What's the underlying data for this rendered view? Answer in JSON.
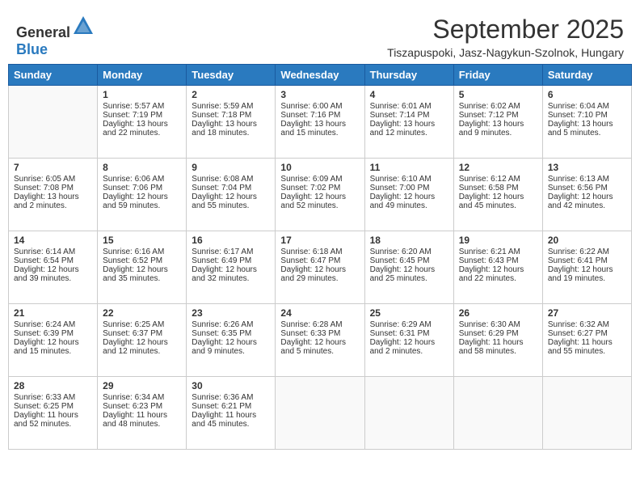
{
  "header": {
    "logo_general": "General",
    "logo_blue": "Blue",
    "month": "September 2025",
    "location": "Tiszapuspoki, Jasz-Nagykun-Szolnok, Hungary"
  },
  "days_of_week": [
    "Sunday",
    "Monday",
    "Tuesday",
    "Wednesday",
    "Thursday",
    "Friday",
    "Saturday"
  ],
  "weeks": [
    [
      {
        "day": "",
        "content": ""
      },
      {
        "day": "1",
        "content": "Sunrise: 5:57 AM\nSunset: 7:19 PM\nDaylight: 13 hours\nand 22 minutes."
      },
      {
        "day": "2",
        "content": "Sunrise: 5:59 AM\nSunset: 7:18 PM\nDaylight: 13 hours\nand 18 minutes."
      },
      {
        "day": "3",
        "content": "Sunrise: 6:00 AM\nSunset: 7:16 PM\nDaylight: 13 hours\nand 15 minutes."
      },
      {
        "day": "4",
        "content": "Sunrise: 6:01 AM\nSunset: 7:14 PM\nDaylight: 13 hours\nand 12 minutes."
      },
      {
        "day": "5",
        "content": "Sunrise: 6:02 AM\nSunset: 7:12 PM\nDaylight: 13 hours\nand 9 minutes."
      },
      {
        "day": "6",
        "content": "Sunrise: 6:04 AM\nSunset: 7:10 PM\nDaylight: 13 hours\nand 5 minutes."
      }
    ],
    [
      {
        "day": "7",
        "content": "Sunrise: 6:05 AM\nSunset: 7:08 PM\nDaylight: 13 hours\nand 2 minutes."
      },
      {
        "day": "8",
        "content": "Sunrise: 6:06 AM\nSunset: 7:06 PM\nDaylight: 12 hours\nand 59 minutes."
      },
      {
        "day": "9",
        "content": "Sunrise: 6:08 AM\nSunset: 7:04 PM\nDaylight: 12 hours\nand 55 minutes."
      },
      {
        "day": "10",
        "content": "Sunrise: 6:09 AM\nSunset: 7:02 PM\nDaylight: 12 hours\nand 52 minutes."
      },
      {
        "day": "11",
        "content": "Sunrise: 6:10 AM\nSunset: 7:00 PM\nDaylight: 12 hours\nand 49 minutes."
      },
      {
        "day": "12",
        "content": "Sunrise: 6:12 AM\nSunset: 6:58 PM\nDaylight: 12 hours\nand 45 minutes."
      },
      {
        "day": "13",
        "content": "Sunrise: 6:13 AM\nSunset: 6:56 PM\nDaylight: 12 hours\nand 42 minutes."
      }
    ],
    [
      {
        "day": "14",
        "content": "Sunrise: 6:14 AM\nSunset: 6:54 PM\nDaylight: 12 hours\nand 39 minutes."
      },
      {
        "day": "15",
        "content": "Sunrise: 6:16 AM\nSunset: 6:52 PM\nDaylight: 12 hours\nand 35 minutes."
      },
      {
        "day": "16",
        "content": "Sunrise: 6:17 AM\nSunset: 6:49 PM\nDaylight: 12 hours\nand 32 minutes."
      },
      {
        "day": "17",
        "content": "Sunrise: 6:18 AM\nSunset: 6:47 PM\nDaylight: 12 hours\nand 29 minutes."
      },
      {
        "day": "18",
        "content": "Sunrise: 6:20 AM\nSunset: 6:45 PM\nDaylight: 12 hours\nand 25 minutes."
      },
      {
        "day": "19",
        "content": "Sunrise: 6:21 AM\nSunset: 6:43 PM\nDaylight: 12 hours\nand 22 minutes."
      },
      {
        "day": "20",
        "content": "Sunrise: 6:22 AM\nSunset: 6:41 PM\nDaylight: 12 hours\nand 19 minutes."
      }
    ],
    [
      {
        "day": "21",
        "content": "Sunrise: 6:24 AM\nSunset: 6:39 PM\nDaylight: 12 hours\nand 15 minutes."
      },
      {
        "day": "22",
        "content": "Sunrise: 6:25 AM\nSunset: 6:37 PM\nDaylight: 12 hours\nand 12 minutes."
      },
      {
        "day": "23",
        "content": "Sunrise: 6:26 AM\nSunset: 6:35 PM\nDaylight: 12 hours\nand 9 minutes."
      },
      {
        "day": "24",
        "content": "Sunrise: 6:28 AM\nSunset: 6:33 PM\nDaylight: 12 hours\nand 5 minutes."
      },
      {
        "day": "25",
        "content": "Sunrise: 6:29 AM\nSunset: 6:31 PM\nDaylight: 12 hours\nand 2 minutes."
      },
      {
        "day": "26",
        "content": "Sunrise: 6:30 AM\nSunset: 6:29 PM\nDaylight: 11 hours\nand 58 minutes."
      },
      {
        "day": "27",
        "content": "Sunrise: 6:32 AM\nSunset: 6:27 PM\nDaylight: 11 hours\nand 55 minutes."
      }
    ],
    [
      {
        "day": "28",
        "content": "Sunrise: 6:33 AM\nSunset: 6:25 PM\nDaylight: 11 hours\nand 52 minutes."
      },
      {
        "day": "29",
        "content": "Sunrise: 6:34 AM\nSunset: 6:23 PM\nDaylight: 11 hours\nand 48 minutes."
      },
      {
        "day": "30",
        "content": "Sunrise: 6:36 AM\nSunset: 6:21 PM\nDaylight: 11 hours\nand 45 minutes."
      },
      {
        "day": "",
        "content": ""
      },
      {
        "day": "",
        "content": ""
      },
      {
        "day": "",
        "content": ""
      },
      {
        "day": "",
        "content": ""
      }
    ]
  ]
}
